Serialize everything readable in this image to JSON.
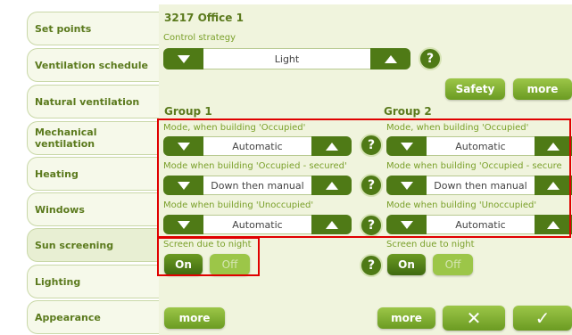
{
  "tabs": [
    {
      "label": "Set points"
    },
    {
      "label": "Ventilation schedule"
    },
    {
      "label": "Natural ventilation"
    },
    {
      "label": "Mechanical ventilation"
    },
    {
      "label": "Heating"
    },
    {
      "label": "Windows"
    },
    {
      "label": "Sun screening"
    },
    {
      "label": "Lighting"
    },
    {
      "label": "Appearance"
    }
  ],
  "page_title": "3217 Office 1",
  "control_strategy": {
    "label": "Control strategy",
    "value": "Light",
    "help": "?"
  },
  "buttons": {
    "safety": "Safety",
    "more_top": "more",
    "more_bottom_left": "more",
    "more_bottom_right": "more",
    "cancel": "✕",
    "confirm": "✓"
  },
  "group1": {
    "title": "Group 1",
    "occupied": {
      "label": "Mode, when building 'Occupied'",
      "value": "Automatic"
    },
    "secured": {
      "label": "Mode when building 'Occupied - secured'",
      "value": "Down then manual"
    },
    "unoccupied": {
      "label": "Mode when building 'Unoccupied'",
      "value": "Automatic"
    },
    "night": {
      "label": "Screen due to night",
      "on": "On",
      "off": "Off"
    }
  },
  "group2": {
    "title": "Group 2",
    "occupied": {
      "label": "Mode, when building 'Occupied'",
      "value": "Automatic"
    },
    "secured": {
      "label": "Mode when building 'Occupied - secure",
      "value": "Down then manual"
    },
    "unoccupied": {
      "label": "Mode when building 'Unoccupied'",
      "value": "Automatic"
    },
    "night": {
      "label": "Screen due to night",
      "on": "On",
      "off": "Off"
    }
  },
  "help_labels": {
    "q": "?"
  },
  "colors": {
    "accent": "#4f7a16",
    "highlight": "#e00000",
    "panel": "#f0f4dd"
  }
}
